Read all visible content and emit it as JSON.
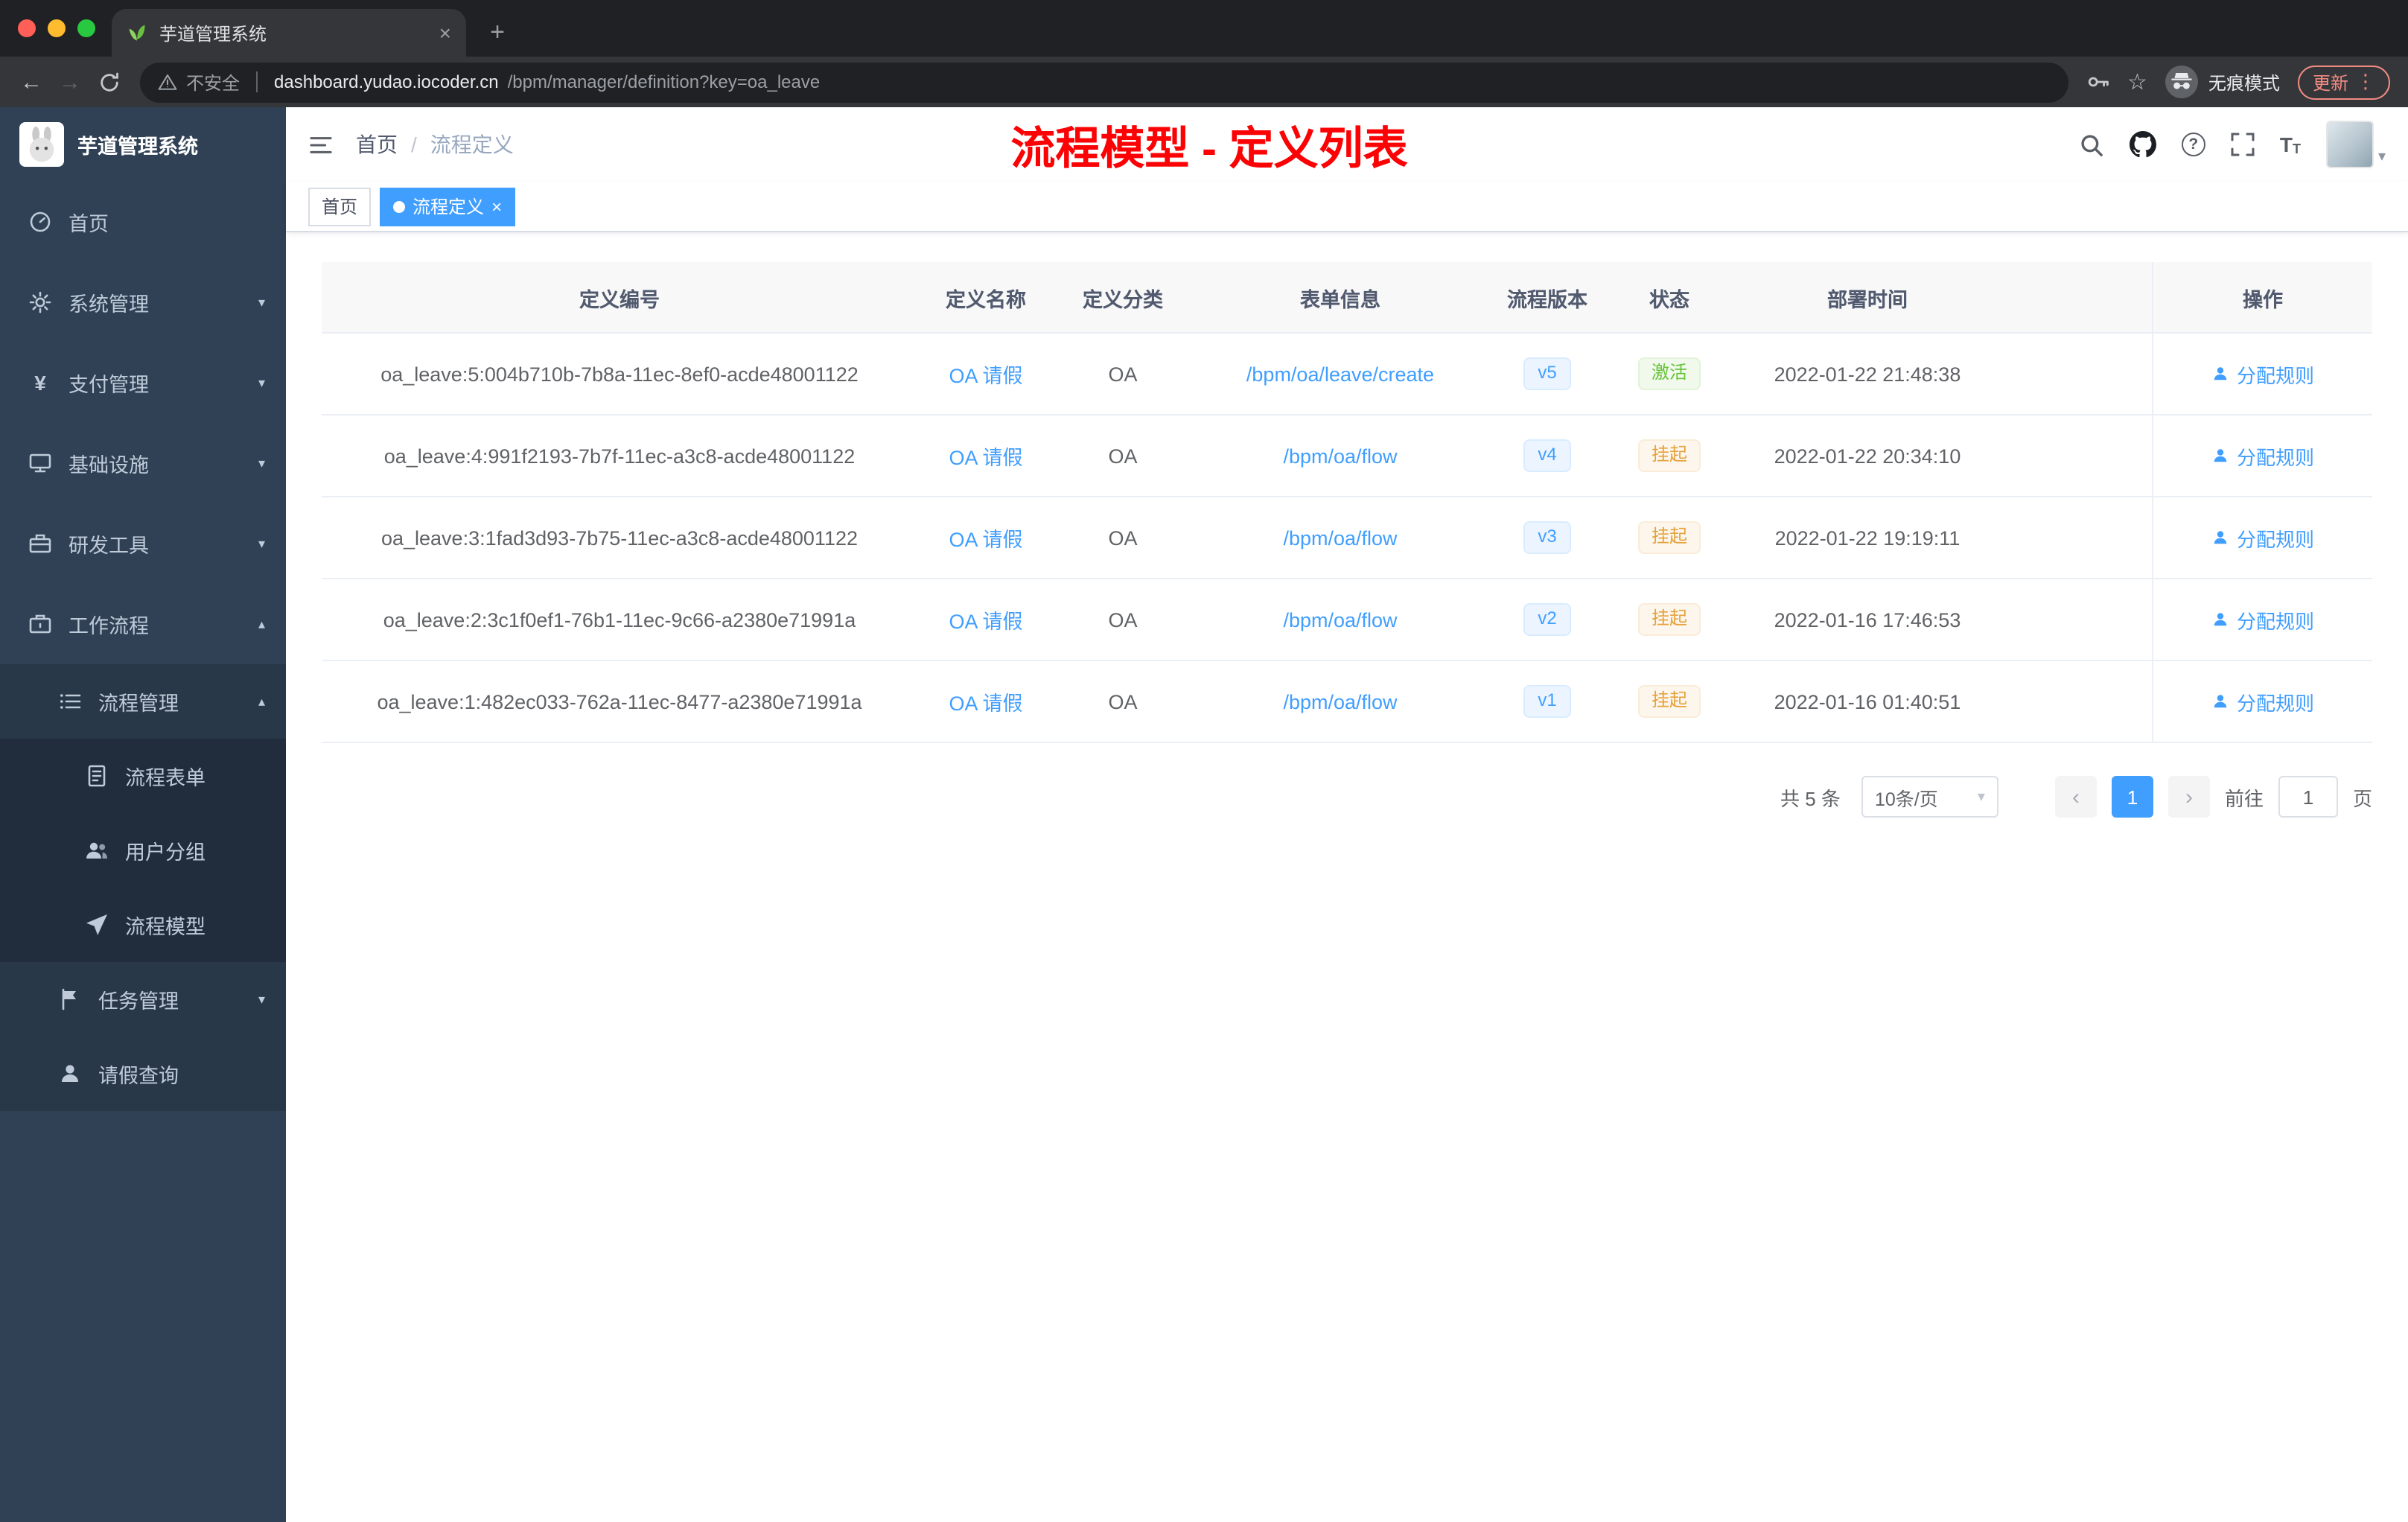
{
  "browser": {
    "tab": {
      "title": "芋道管理系统",
      "favicon": "sprout-icon"
    },
    "toolbar": {
      "security_label": "不安全",
      "url_host": "dashboard.yudao.iocoder.cn",
      "url_path": "/bpm/manager/definition?key=oa_leave",
      "incognito_label": "无痕模式",
      "update_label": "更新"
    }
  },
  "sidebar": {
    "logo_title": "芋道管理系统",
    "items": [
      {
        "label": "首页",
        "icon": "dashboard-icon"
      },
      {
        "label": "系统管理",
        "icon": "gear-icon",
        "state": "collapsed"
      },
      {
        "label": "支付管理",
        "icon": "yen-icon",
        "state": "collapsed"
      },
      {
        "label": "基础设施",
        "icon": "monitor-icon",
        "state": "collapsed"
      },
      {
        "label": "研发工具",
        "icon": "toolbox-icon",
        "state": "collapsed"
      },
      {
        "label": "工作流程",
        "icon": "briefcase-icon",
        "state": "expanded"
      },
      {
        "label": "流程管理",
        "icon": "list-icon",
        "state": "expanded"
      },
      {
        "label": "流程表单",
        "icon": "form-icon"
      },
      {
        "label": "用户分组",
        "icon": "users-icon"
      },
      {
        "label": "流程模型",
        "icon": "send-icon"
      },
      {
        "label": "任务管理",
        "icon": "flag-icon",
        "state": "collapsed"
      },
      {
        "label": "请假查询",
        "icon": "user-icon"
      }
    ]
  },
  "header": {
    "breadcrumb": {
      "home": "首页",
      "separator": "/",
      "current": "流程定义"
    },
    "annotation": "流程模型 - 定义列表",
    "icons": [
      "search-icon",
      "github-icon",
      "help-icon",
      "fullscreen-icon",
      "font-size-icon",
      "avatar",
      "caret-down-icon"
    ]
  },
  "tags": {
    "home": "首页",
    "active": "流程定义"
  },
  "table": {
    "columns": [
      "定义编号",
      "定义名称",
      "定义分类",
      "表单信息",
      "流程版本",
      "状态",
      "部署时间",
      "操作"
    ],
    "rows": [
      {
        "id": "oa_leave:5:004b710b-7b8a-11ec-8ef0-acde48001122",
        "name": "OA 请假",
        "category": "OA",
        "form": "/bpm/oa/leave/create",
        "version": "v5",
        "status": "激活",
        "status_type": "success",
        "deploy_time": "2022-01-22 21:48:38",
        "action": "分配规则"
      },
      {
        "id": "oa_leave:4:991f2193-7b7f-11ec-a3c8-acde48001122",
        "name": "OA 请假",
        "category": "OA",
        "form": "/bpm/oa/flow",
        "version": "v4",
        "status": "挂起",
        "status_type": "warning",
        "deploy_time": "2022-01-22 20:34:10",
        "action": "分配规则"
      },
      {
        "id": "oa_leave:3:1fad3d93-7b75-11ec-a3c8-acde48001122",
        "name": "OA 请假",
        "category": "OA",
        "form": "/bpm/oa/flow",
        "version": "v3",
        "status": "挂起",
        "status_type": "warning",
        "deploy_time": "2022-01-22 19:19:11",
        "action": "分配规则"
      },
      {
        "id": "oa_leave:2:3c1f0ef1-76b1-11ec-9c66-a2380e71991a",
        "name": "OA 请假",
        "category": "OA",
        "form": "/bpm/oa/flow",
        "version": "v2",
        "status": "挂起",
        "status_type": "warning",
        "deploy_time": "2022-01-16 17:46:53",
        "action": "分配规则"
      },
      {
        "id": "oa_leave:1:482ec033-762a-11ec-8477-a2380e71991a",
        "name": "OA 请假",
        "category": "OA",
        "form": "/bpm/oa/flow",
        "version": "v1",
        "status": "挂起",
        "status_type": "warning",
        "deploy_time": "2022-01-16 01:40:51",
        "action": "分配规则"
      }
    ]
  },
  "pagination": {
    "total": "共 5 条",
    "page_size": "10条/页",
    "current_page": "1",
    "goto_label": "前往",
    "goto_value": "1",
    "goto_suffix": "页"
  },
  "colors": {
    "accent": "#409eff",
    "success": "#67c23a",
    "warning": "#e6a23c",
    "annotation_red": "#fb0205",
    "sidebar_bg": "#304156"
  }
}
